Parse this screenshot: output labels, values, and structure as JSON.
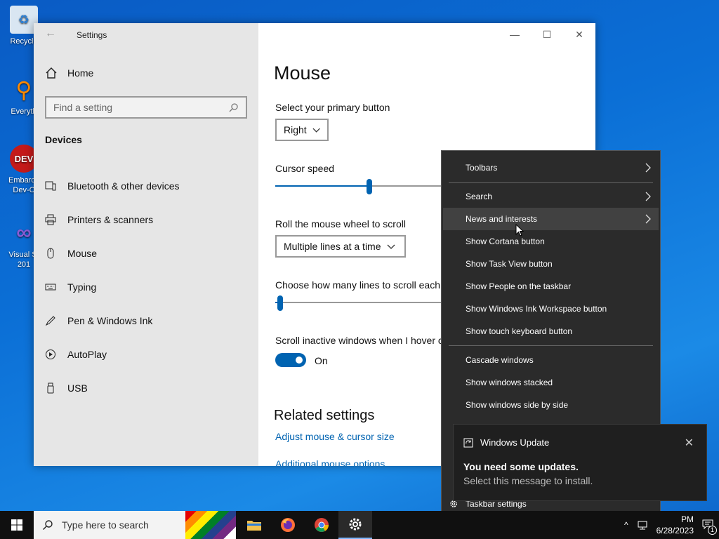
{
  "desktop": {
    "icons": [
      {
        "label": "Recycle"
      },
      {
        "label": "Everyth"
      },
      {
        "label": "Embarca Dev-C"
      },
      {
        "label": "Visual St 201"
      }
    ]
  },
  "settings": {
    "window_title": "Settings",
    "home_label": "Home",
    "search_placeholder": "Find a setting",
    "section": "Devices",
    "nav": [
      {
        "label": "Bluetooth & other devices"
      },
      {
        "label": "Printers & scanners"
      },
      {
        "label": "Mouse"
      },
      {
        "label": "Typing"
      },
      {
        "label": "Pen & Windows Ink"
      },
      {
        "label": "AutoPlay"
      },
      {
        "label": "USB"
      }
    ],
    "page_title": "Mouse",
    "primary_button_label": "Select your primary button",
    "primary_button_value": "Right",
    "cursor_speed_label": "Cursor speed",
    "cursor_speed_level": 0.56,
    "scroll_label": "Roll the mouse wheel to scroll",
    "scroll_value": "Multiple lines at a time",
    "lines_label": "Choose how many lines to scroll each",
    "lines_level": 0.03,
    "inactive_label": "Scroll inactive windows when I hover c",
    "inactive_state": "On",
    "related_title": "Related settings",
    "link1": "Adjust mouse & cursor size",
    "link2": "Additional mouse options"
  },
  "context_menu": {
    "items": [
      {
        "label": "Toolbars"
      },
      {
        "label": "Search"
      },
      {
        "label": "News and interests"
      },
      {
        "label": "Show Cortana button"
      },
      {
        "label": "Show Task View button"
      },
      {
        "label": "Show People on the taskbar"
      },
      {
        "label": "Show Windows Ink Workspace button"
      },
      {
        "label": "Show touch keyboard button"
      },
      {
        "label": "Cascade windows"
      },
      {
        "label": "Show windows stacked"
      },
      {
        "label": "Show windows side by side"
      }
    ],
    "taskbar_settings": "Taskbar settings"
  },
  "toast": {
    "app": "Windows Update",
    "title": "You need some updates.",
    "body": "Select this message to install."
  },
  "taskbar": {
    "search_placeholder": "Type here to search",
    "time": "PM",
    "date": "6/28/2023",
    "notifications": "1"
  },
  "colors": {
    "accent": "#0063b1",
    "menu_bg": "#2b2b2b",
    "sidebar_bg": "#e6e6e6"
  }
}
